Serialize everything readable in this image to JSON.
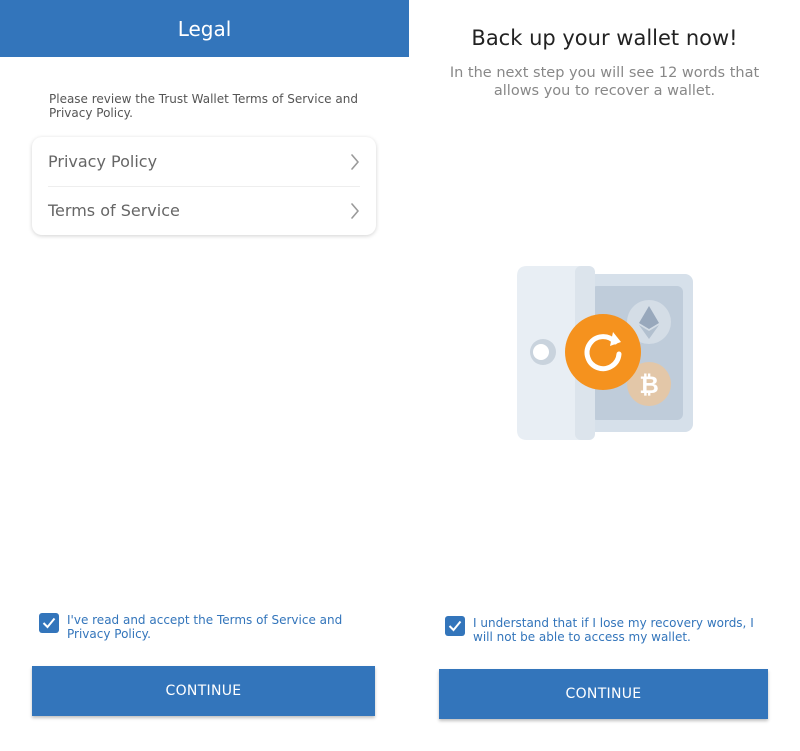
{
  "legal_screen": {
    "title": "Legal",
    "intro": "Please review the Trust Wallet Terms of Service and Privacy Policy.",
    "items": [
      {
        "label": "Privacy Policy",
        "icon": "chevron-right-icon"
      },
      {
        "label": "Terms of Service",
        "icon": "chevron-right-icon"
      }
    ],
    "accept": {
      "checked": true,
      "label": "I've read and accept the Terms of Service and Privacy Policy."
    },
    "continue_label": "CONTINUE"
  },
  "backup_screen": {
    "title": "Back up your wallet now!",
    "subtitle": "In the next step you will see 12 words that allows you to recover a wallet.",
    "illustration": {
      "icons": [
        "safe-icon",
        "refresh-icon",
        "ethereum-icon",
        "bitcoin-icon"
      ]
    },
    "acknowledge": {
      "checked": true,
      "label": "I understand that if I lose my recovery words, I will not be able to access my wallet."
    },
    "continue_label": "CONTINUE"
  },
  "colors": {
    "primary": "#3375BB",
    "accent_orange": "#F5921E"
  }
}
